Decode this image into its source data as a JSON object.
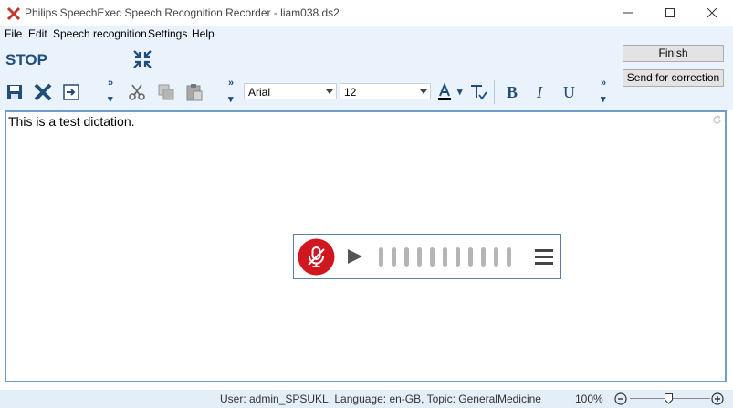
{
  "window": {
    "title": "Philips SpeechExec Speech Recognition Recorder - liam038.ds2"
  },
  "menu": [
    {
      "label": "File"
    },
    {
      "label": "Edit"
    },
    {
      "label": "Speech recognition"
    },
    {
      "label": "Settings"
    },
    {
      "label": "Help"
    }
  ],
  "toolbar": {
    "state_label": "STOP",
    "font_name": "Arial",
    "font_size": "12",
    "bold_label": "B",
    "italic_label": "I",
    "underline_label": "U"
  },
  "actions": {
    "finish_label": "Finish",
    "send_label": "Send for correction"
  },
  "editor": {
    "text": "This is a test dictation."
  },
  "status": {
    "info": "User:  admin_SPSUKL, Language:  en-GB, Topic:  GeneralMedicine",
    "zoom": "100%"
  },
  "colors": {
    "accent": "#1f4e79",
    "record_red": "#d0161e",
    "toolbar_bg": "#eaf2fb"
  }
}
